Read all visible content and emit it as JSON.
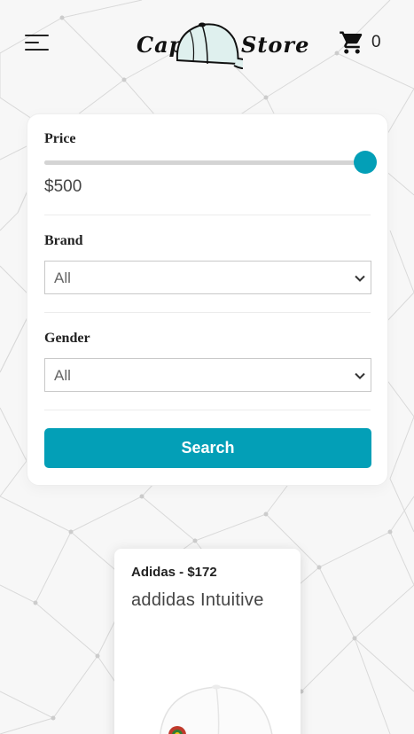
{
  "header": {
    "logo_left": "Cap",
    "logo_right": "Store",
    "cart_count": "0"
  },
  "filters": {
    "price": {
      "label": "Price",
      "value": 500,
      "max": 500,
      "display": "$500",
      "accent": "#039fb7"
    },
    "brand": {
      "label": "Brand",
      "selected": "All"
    },
    "gender": {
      "label": "Gender",
      "selected": "All"
    },
    "search_label": "Search"
  },
  "products": [
    {
      "meta": "Adidas - $172",
      "name": "addidas Intuitive"
    }
  ],
  "icons": {
    "menu": "hamburger-menu-icon",
    "logo": "baseball-cap-icon",
    "cart": "shopping-cart-icon",
    "select": "chevron-down-icon"
  }
}
